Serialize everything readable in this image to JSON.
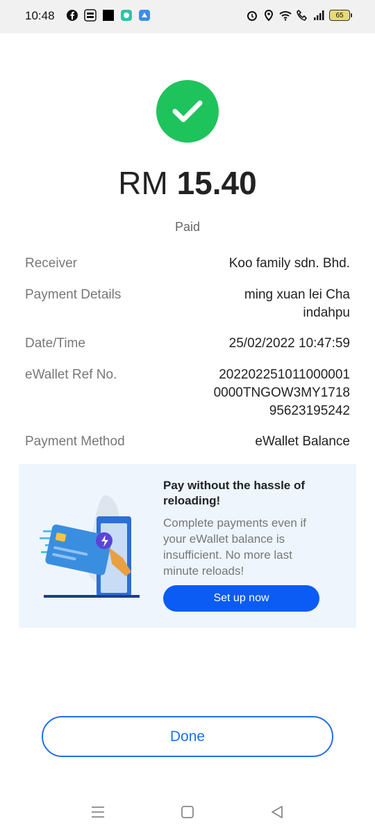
{
  "status_bar": {
    "time": "10:48",
    "battery": "65",
    "left_icons": [
      "facebook-icon",
      "touchngo-icon",
      "black-square-icon",
      "chat-icon",
      "app-icon"
    ],
    "right_icons": [
      "alarm-icon",
      "location-icon",
      "wifi-icon",
      "volte-call-icon",
      "signal-icon",
      "battery-icon"
    ]
  },
  "result": {
    "currency": "RM",
    "amount": "15.40",
    "status": "Paid",
    "accent": "#1fc35c"
  },
  "details": [
    {
      "label": "Receiver",
      "value": [
        "Koo family sdn. Bhd."
      ]
    },
    {
      "label": "Payment Details",
      "value": [
        "ming xuan lei Cha",
        "indahpu"
      ]
    },
    {
      "label": "Date/Time",
      "value": [
        "25/02/2022 10:47:59"
      ]
    },
    {
      "label": "eWallet Ref No.",
      "value": [
        "20220225101100000​1",
        "0000TNGOW3MY1718",
        "95623195242"
      ]
    },
    {
      "label": "Payment Method",
      "value": [
        "eWallet Balance"
      ]
    }
  ],
  "promo": {
    "title": "Pay without the hassle of reloading!",
    "description": "Complete payments even if your eWallet balance is insufficient. No more last minute reloads!",
    "button": "Set up now",
    "button_color": "#0a5cf5"
  },
  "done_label": "Done",
  "nav": [
    "menu-icon",
    "home-icon",
    "back-icon"
  ]
}
